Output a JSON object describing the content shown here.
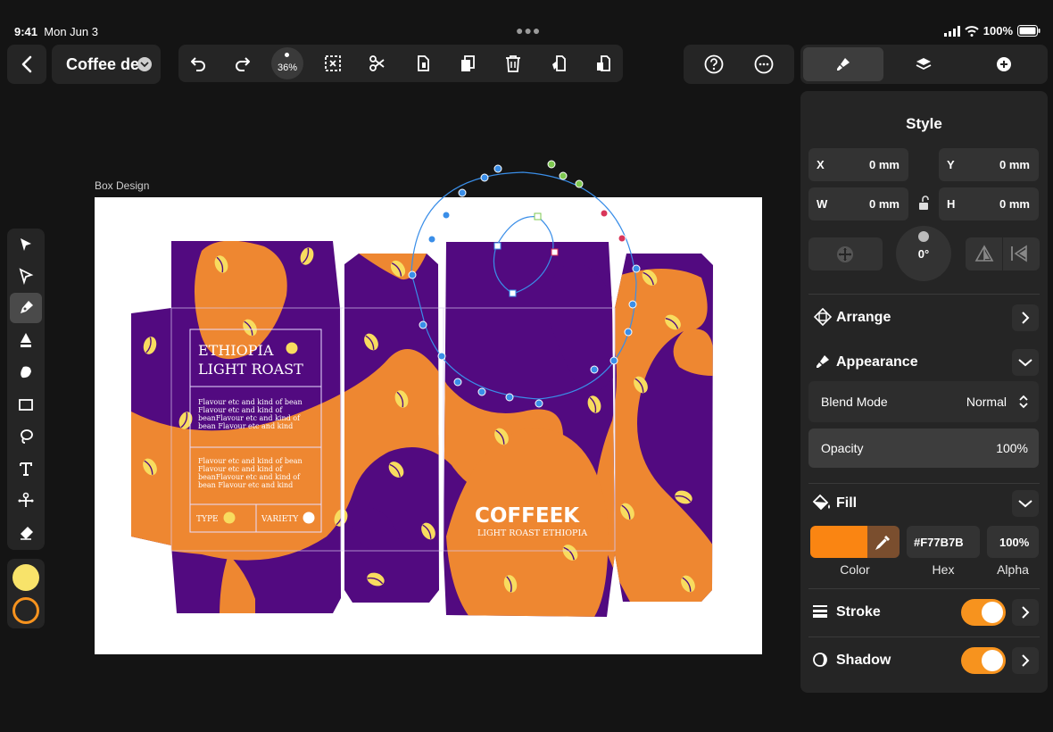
{
  "status": {
    "time": "9:41",
    "date": "Mon Jun 3",
    "battery": "100%"
  },
  "document": {
    "title": "Coffee de",
    "zoom": "36%"
  },
  "artboard": {
    "label": "Box Design"
  },
  "design": {
    "title_line1": "ETHIOPIA",
    "title_line2": "LIGHT ROAST",
    "description1": [
      "Flavour etc and kind of bean",
      "Flavour etc and kind of",
      "beanFlavour etc and kind of",
      "bean Flavour etc and kind"
    ],
    "description2": [
      "Flavour etc and kind of bean",
      "Flavour etc and kind of",
      "beanFlavour etc and kind of",
      "bean Flavour etc and kind"
    ],
    "type_label": "TYPE",
    "variety_label": "VARIETY",
    "brand": "COFFEEK",
    "brand_sub": "LIGHT ROAST ETHIOPIA",
    "colors": {
      "purple": "#520a80",
      "orange": "#ee8731",
      "bean": "#f8dc5f"
    }
  },
  "panel": {
    "title": "Style",
    "x_label": "X",
    "x_value": "0 mm",
    "y_label": "Y",
    "y_value": "0 mm",
    "w_label": "W",
    "w_value": "0 mm",
    "h_label": "H",
    "h_value": "0 mm",
    "rotation": "0°",
    "arrange": "Arrange",
    "appearance": "Appearance",
    "blend_label": "Blend Mode",
    "blend_value": "Normal",
    "opacity_label": "Opacity",
    "opacity_value": "100%",
    "fill": "Fill",
    "fill_hex": "#F77B7B",
    "fill_alpha": "100%",
    "color_caption": "Color",
    "hex_caption": "Hex",
    "alpha_caption": "Alpha",
    "stroke": "Stroke",
    "shadow": "Shadow"
  },
  "swatches": {
    "fill": "#f8e36a",
    "stroke": "#f7931e"
  }
}
